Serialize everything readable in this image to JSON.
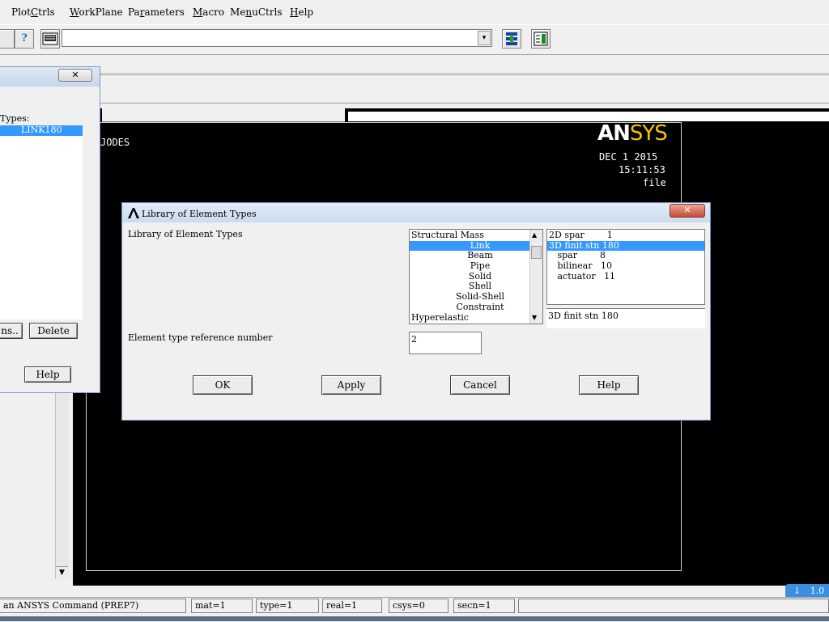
{
  "menubar": {
    "items": [
      {
        "pre": "Plot",
        "u": "C",
        "post": "trls"
      },
      {
        "pre": "",
        "u": "W",
        "post": "orkPlane"
      },
      {
        "pre": "Pa",
        "u": "r",
        "post": "ameters"
      },
      {
        "pre": "",
        "u": "M",
        "post": "acro"
      },
      {
        "pre": "Me",
        "u": "n",
        "post": "uCtrls"
      },
      {
        "pre": "",
        "u": "H",
        "post": "elp"
      }
    ]
  },
  "toolbar": {
    "help_glyph": "?",
    "command_value": ""
  },
  "left_panel": {
    "list_label": "Types:",
    "items": [
      "LINK180"
    ],
    "options_button": "ns..",
    "delete_button": "Delete",
    "help_button": "Help",
    "close_glyph": "✕"
  },
  "graphics": {
    "label": "JODES",
    "logo_an": "AN",
    "logo_sys": "SYS",
    "date": "DEC  1 2015",
    "time": "15:11:53",
    "file": "file"
  },
  "dialog": {
    "title": "Library of Element Types",
    "close_glyph": "✕",
    "library_label": "Library of Element Types",
    "categories": [
      "Structural Mass",
      "Link",
      "Beam",
      "Pipe",
      "Solid",
      "Shell",
      "Solid-Shell",
      "Constraint",
      "Hyperelastic"
    ],
    "selected_category": 1,
    "types": [
      "2D spar        1",
      "3D finit stn 180",
      "   spar        8",
      "   bilinear   10",
      "   actuator   11"
    ],
    "selected_type": 1,
    "selected_type_value": "3D finit stn 180",
    "ref_label": "Element type reference number",
    "ref_value": "2",
    "ok": "OK",
    "apply": "Apply",
    "cancel": "Cancel",
    "help": "Help"
  },
  "statusbar": {
    "prompt": "an ANSYS Command (PREP7)",
    "mat": "mat=1",
    "type": "type=1",
    "real": "real=1",
    "csys": "csys=0",
    "secn": "secn=1"
  },
  "tray": {
    "text": "1.0"
  }
}
